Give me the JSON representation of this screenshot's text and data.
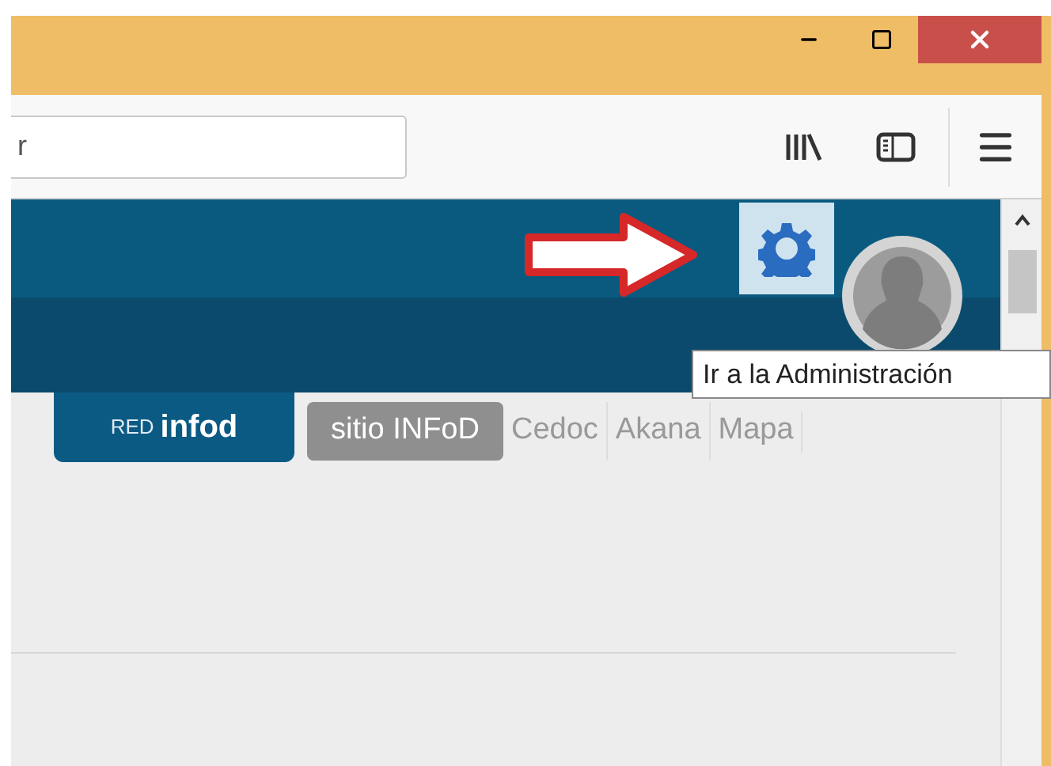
{
  "address_bar": {
    "value": "r"
  },
  "header": {
    "tooltip": "Ir a la Administración"
  },
  "logo": {
    "prefix": "RED",
    "name": "infod"
  },
  "nav_tabs": [
    {
      "label": "sitio INFoD",
      "selected": true
    },
    {
      "label": "Cedoc",
      "selected": false
    },
    {
      "label": "Akana",
      "selected": false
    },
    {
      "label": "Mapa",
      "selected": false
    }
  ]
}
